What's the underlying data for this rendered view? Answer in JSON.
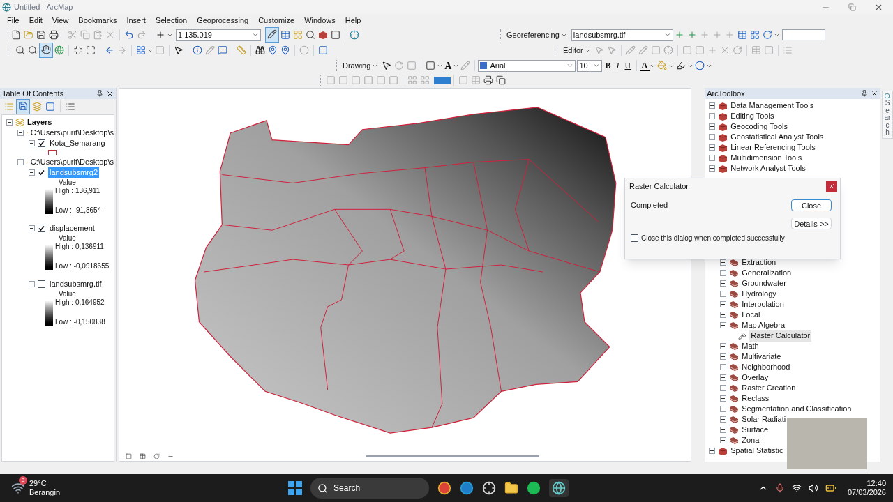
{
  "window": {
    "title": "Untitled - ArcMap"
  },
  "menu": [
    "File",
    "Edit",
    "View",
    "Bookmarks",
    "Insert",
    "Selection",
    "Geoprocessing",
    "Customize",
    "Windows",
    "Help"
  ],
  "toolbars": {
    "scale": "1:135.019",
    "georeferencing": {
      "label": "Georeferencing",
      "layer": "landsubsmrg.tif"
    },
    "editor": {
      "label": "Editor"
    },
    "drawing": {
      "label": "Drawing",
      "font": "Arial",
      "size": "10",
      "format_buttons": [
        "B",
        "I",
        "U"
      ],
      "text_tool_button": "A",
      "text_color_button": "A"
    }
  },
  "toc": {
    "title": "Table Of Contents",
    "root": {
      "kind": "root",
      "name": "Layers",
      "expanded": true,
      "children": [
        {
          "kind": "group",
          "name": "C:\\Users\\purit\\Desktop\\s",
          "expanded": true,
          "children": [
            {
              "kind": "layer",
              "name": "Kota_Semarang",
              "expanded": true,
              "checked": true,
              "selected": false,
              "legend": {
                "kind": "polygon"
              }
            }
          ]
        },
        {
          "kind": "group",
          "name": "C:\\Users\\purit\\Desktop\\s",
          "expanded": true,
          "children": [
            {
              "kind": "layer",
              "name": "landsubsmrg2",
              "expanded": true,
              "checked": true,
              "selected": true,
              "legend": {
                "kind": "ramp",
                "heading": "Value",
                "high": "High : 136,911",
                "low": "Low : -91,8654"
              }
            },
            {
              "kind": "layer",
              "name": "displacement",
              "expanded": true,
              "checked": true,
              "selected": false,
              "legend": {
                "kind": "ramp",
                "heading": "Value",
                "high": "High : 0,136911",
                "low": "Low : -0,0918655"
              }
            },
            {
              "kind": "layer",
              "name": "landsubsmrg.tif",
              "expanded": true,
              "checked": false,
              "selected": false,
              "legend": {
                "kind": "ramp",
                "heading": "Value",
                "high": "High : 0,164952",
                "low": "Low : -0,150838"
              }
            }
          ]
        }
      ]
    }
  },
  "toolbox": {
    "title": "ArcToolbox",
    "search_tab": "Search",
    "top_items": [
      {
        "name": "Data Management Tools",
        "expanded": false
      },
      {
        "name": "Editing Tools",
        "expanded": false
      },
      {
        "name": "Geocoding Tools",
        "expanded": false
      },
      {
        "name": "Geostatistical Analyst Tools",
        "expanded": false
      },
      {
        "name": "Linear Referencing Tools",
        "expanded": false
      },
      {
        "name": "Multidimension Tools",
        "expanded": false
      },
      {
        "name": "Network Analyst Tools",
        "expanded": false
      }
    ],
    "nested_items": [
      {
        "name": "Extraction",
        "expanded": false
      },
      {
        "name": "Generalization",
        "expanded": false
      },
      {
        "name": "Groundwater",
        "expanded": false
      },
      {
        "name": "Hydrology",
        "expanded": false
      },
      {
        "name": "Interpolation",
        "expanded": false
      },
      {
        "name": "Local",
        "expanded": false
      },
      {
        "name": "Map Algebra",
        "expanded": true,
        "children": [
          {
            "name": "Raster Calculator",
            "selected": true
          }
        ]
      },
      {
        "name": "Math",
        "expanded": false
      },
      {
        "name": "Multivariate",
        "expanded": false
      },
      {
        "name": "Neighborhood",
        "expanded": false
      },
      {
        "name": "Overlay",
        "expanded": false
      },
      {
        "name": "Raster Creation",
        "expanded": false
      },
      {
        "name": "Reclass",
        "expanded": false
      },
      {
        "name": "Segmentation and Classification",
        "expanded": false
      },
      {
        "name": "Solar Radiati",
        "expanded": false
      },
      {
        "name": "Surface",
        "expanded": false
      },
      {
        "name": "Zonal",
        "expanded": false
      }
    ],
    "bottom_items": [
      {
        "name": "Spatial Statistic",
        "expanded": false
      }
    ]
  },
  "dialog": {
    "title": "Raster Calculator",
    "message": "Completed",
    "close_button": "Close",
    "details_button": "Details >>",
    "checkbox": {
      "label": "Close this dialog when completed successfully",
      "checked": false
    }
  },
  "taskbar": {
    "weather": {
      "temp": "29°C",
      "condition": "Berangin",
      "badge": "3"
    },
    "search": "Search",
    "time": "12:40",
    "date": "07/03/2026"
  }
}
